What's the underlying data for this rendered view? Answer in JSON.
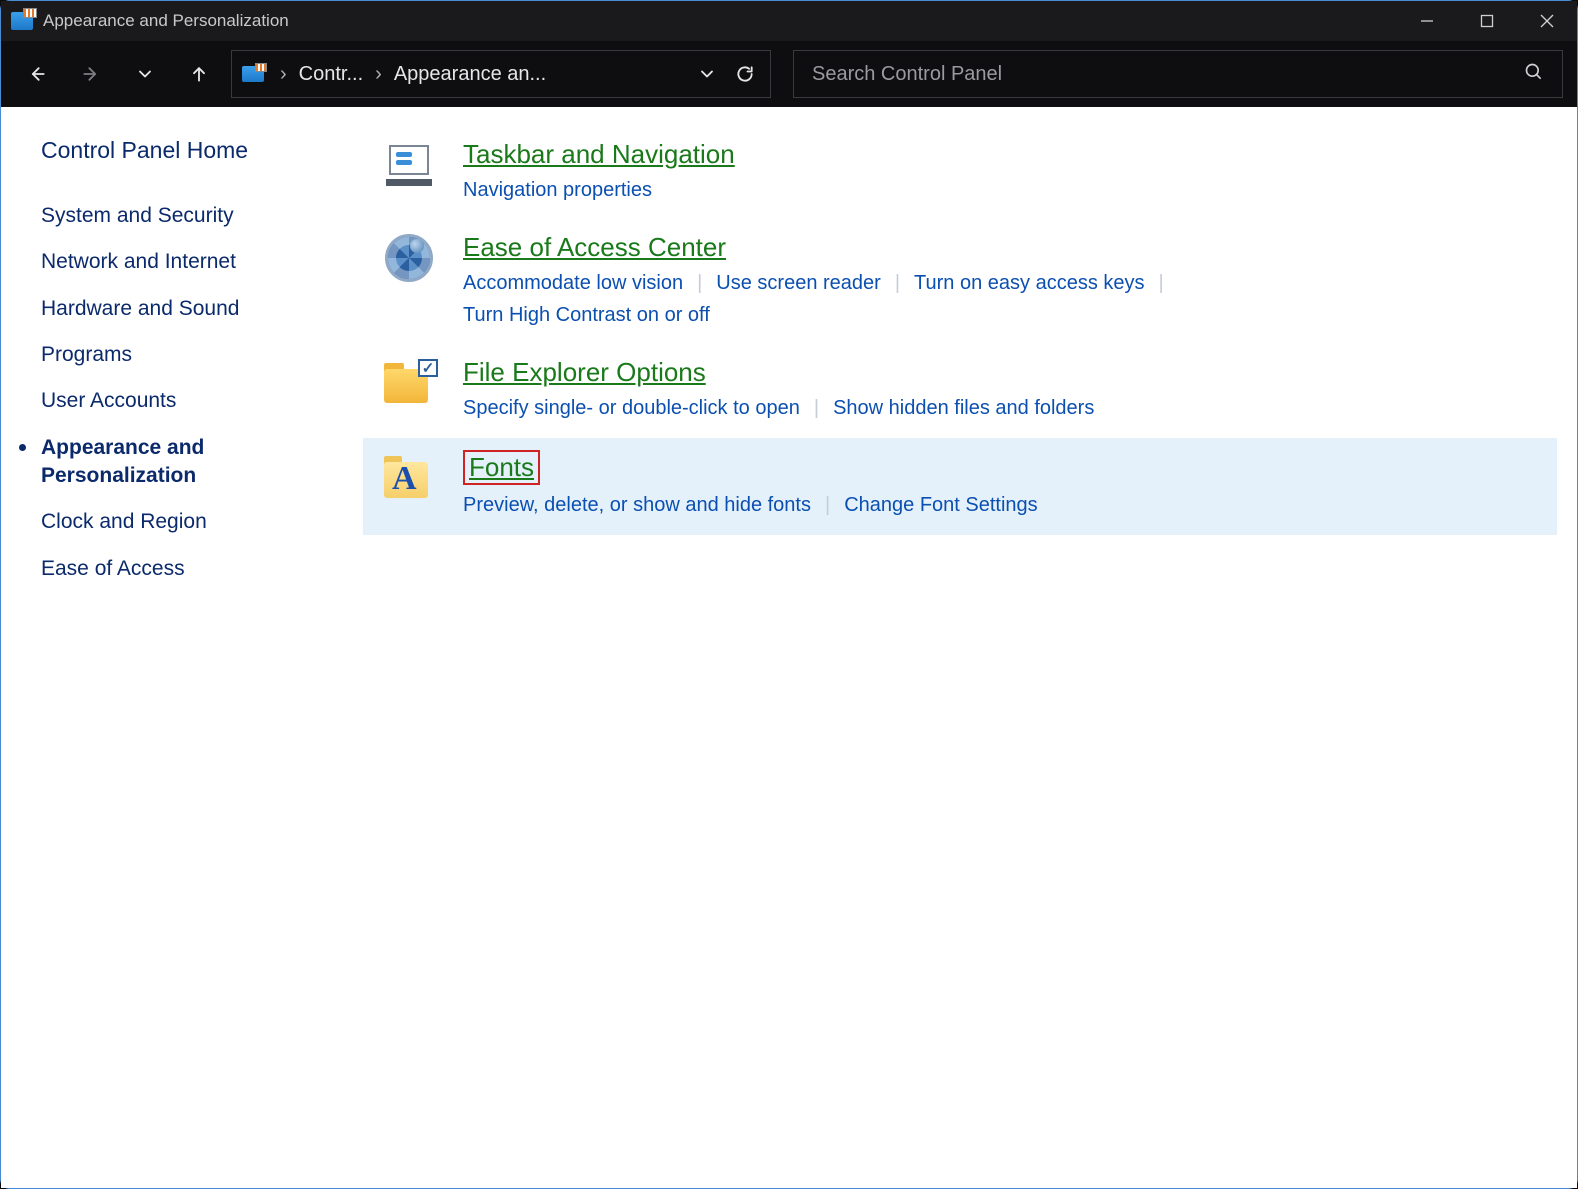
{
  "window": {
    "title": "Appearance and Personalization"
  },
  "breadcrumb": {
    "c1": "Contr...",
    "c2": "Appearance an..."
  },
  "search": {
    "placeholder": "Search Control Panel"
  },
  "sidebar": {
    "home": "Control Panel Home",
    "items": [
      "System and Security",
      "Network and Internet",
      "Hardware and Sound",
      "Programs",
      "User Accounts",
      "Appearance and Personalization",
      "Clock and Region",
      "Ease of Access"
    ]
  },
  "categories": [
    {
      "title": "Taskbar and Navigation",
      "links": [
        "Navigation properties"
      ]
    },
    {
      "title": "Ease of Access Center",
      "links": [
        "Accommodate low vision",
        "Use screen reader",
        "Turn on easy access keys",
        "Turn High Contrast on or off"
      ]
    },
    {
      "title": "File Explorer Options",
      "links": [
        "Specify single- or double-click to open",
        "Show hidden files and folders"
      ]
    },
    {
      "title": "Fonts",
      "links": [
        "Preview, delete, or show and hide fonts",
        "Change Font Settings"
      ]
    }
  ]
}
